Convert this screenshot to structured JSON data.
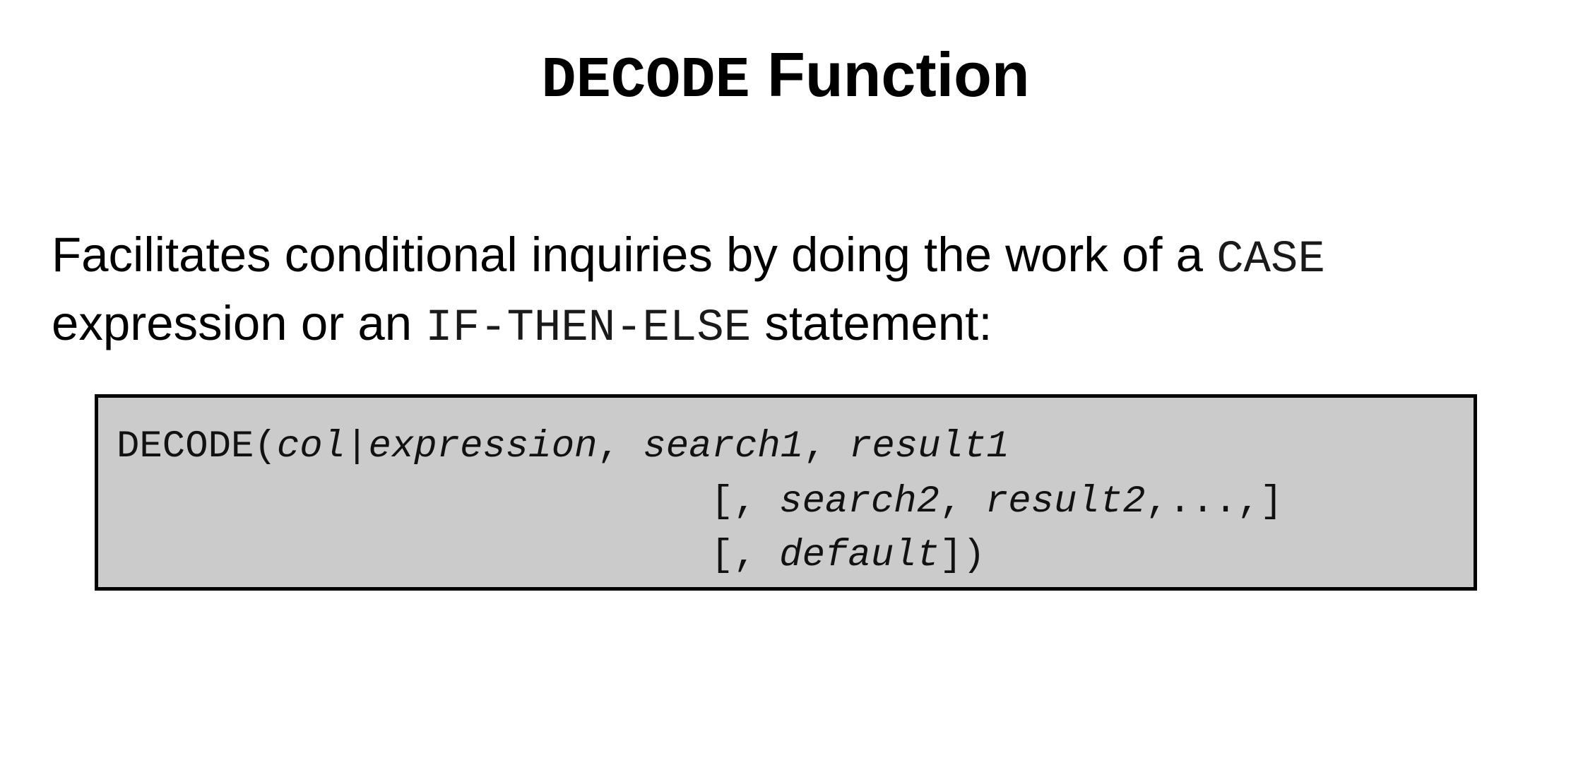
{
  "title": {
    "mono_part": "DECODE",
    "text_part": "Function"
  },
  "description": {
    "line1_text": "Facilitates conditional inquiries by doing the work of a",
    "line1_code": "CASE",
    "line2_text_before": "expression or an",
    "line2_code": "IF-THEN-ELSE",
    "line2_text_after": "statement:"
  },
  "syntax": {
    "line1": {
      "fn": "DECODE(",
      "col": "col",
      "pipe": "|",
      "expression": "expression",
      "sep1": ", ",
      "search1": "search1",
      "sep2": ", ",
      "result1": "result1"
    },
    "line2": {
      "open": "[, ",
      "search2": "search2",
      "sep": ", ",
      "result2": "result2",
      "close": ",...,]"
    },
    "line3": {
      "open": "[, ",
      "default": "default",
      "close": "])"
    }
  },
  "colors": {
    "syntax_box_background": "#cbcbcb",
    "border": "#000000"
  }
}
